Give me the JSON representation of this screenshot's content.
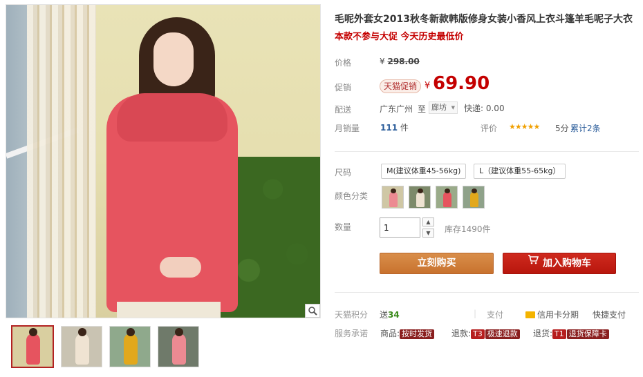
{
  "product": {
    "title": "毛呢外套女2013秋冬新款韩版修身女装小香风上衣斗篷羊毛呢子大衣",
    "promo_line": "本款不参与大促 今天历史最低价"
  },
  "price": {
    "label": "价格",
    "currency": "¥",
    "original": "298.00",
    "promo_label": "促销",
    "promo_badge": "天猫促销",
    "promo_price": "69.90"
  },
  "shipping": {
    "label": "配送",
    "from": "广东广州",
    "to_word": "至",
    "to_city": "廊坊",
    "fee": "快递: 0.00"
  },
  "sales": {
    "label": "月销量",
    "count": "111",
    "unit": "件",
    "rating_label": "评价",
    "stars": "★★★★★",
    "score": "5分",
    "total": "累计2条"
  },
  "options": {
    "size_label": "尺码",
    "sizes": [
      "M(建议体重45-56kg)",
      "L（建议体重55-65kg）"
    ],
    "color_label": "颜色分类"
  },
  "quantity": {
    "label": "数量",
    "value": "1",
    "stock": "库存1490件"
  },
  "actions": {
    "buy": "立刻购买",
    "cart": "加入购物车"
  },
  "footer": {
    "points_label": "天猫积分",
    "points_text": "送",
    "points_value": "34",
    "pay_label": "支付",
    "installment": "信用卡分期",
    "quick_pay": "快捷支付",
    "promise_label": "服务承诺",
    "goods_label": "商品:",
    "goods_tag": "按时发货",
    "refund_label": "退款:",
    "refund_code": "T3",
    "refund_tag": "极速退款",
    "return_label": "退货:",
    "return_code": "T1",
    "return_tag": "退货保障卡"
  },
  "colors": {
    "accent_red": "#c40000",
    "buy_orange": "#c8722e",
    "cart_red": "#b8160d",
    "coat_pink": "#e6545f",
    "coat_cream": "#efe3d2",
    "coat_yellow": "#e2a81c"
  },
  "icons": {
    "zoom": "magnifier-icon",
    "cart": "cart-icon",
    "card": "credit-card-icon",
    "dropdown": "chevron-down-icon"
  }
}
